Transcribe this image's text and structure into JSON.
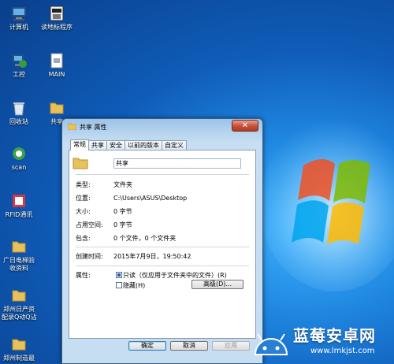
{
  "desktop": {
    "icons": [
      {
        "label": "计算机"
      },
      {
        "label": "读地标程序"
      },
      {
        "label": "工控"
      },
      {
        "label": "MAIN"
      },
      {
        "label": "回收站"
      },
      {
        "label": "共享"
      },
      {
        "label": "scan"
      },
      {
        "label": "RFID通讯"
      },
      {
        "label": "广日电梯验"
      },
      {
        "label": "收资料"
      },
      {
        "label": "郑州日产资"
      },
      {
        "label": "配录Q动Q沾"
      },
      {
        "label": "郑州制造最"
      }
    ]
  },
  "dialog": {
    "title": "共享 属性",
    "close_label": "✕",
    "tabs": [
      "常规",
      "共享",
      "安全",
      "以前的版本",
      "自定义"
    ],
    "active_tab": "常规",
    "name_value": "共享",
    "fields": [
      {
        "key": "类型:",
        "value": "文件夹"
      },
      {
        "key": "位置:",
        "value": "C:\\Users\\ASUS\\Desktop"
      },
      {
        "key": "大小:",
        "value": "0 字节"
      },
      {
        "key": "占用空间:",
        "value": "0 字节"
      },
      {
        "key": "包含:",
        "value": "0 个文件，0 个文件夹"
      },
      {
        "key": "创建时间:",
        "value": "2015年7月9日，19:50:42"
      }
    ],
    "attributes": {
      "label": "属性:",
      "readonly_label": "只读（仅应用于文件夹中的文件）(R)",
      "hidden_label": "隐藏(H)",
      "advanced_button": "高级(D)..."
    },
    "buttons": {
      "ok": "确定",
      "cancel": "取消",
      "apply": "应用"
    }
  },
  "watermark": {
    "name": "蓝莓安卓网",
    "url": "www.lmkjst.com"
  },
  "colors": {
    "desktop_blue": "#1f86e0",
    "close_red": "#c74d35",
    "watermark_blue": "#1976d2"
  }
}
